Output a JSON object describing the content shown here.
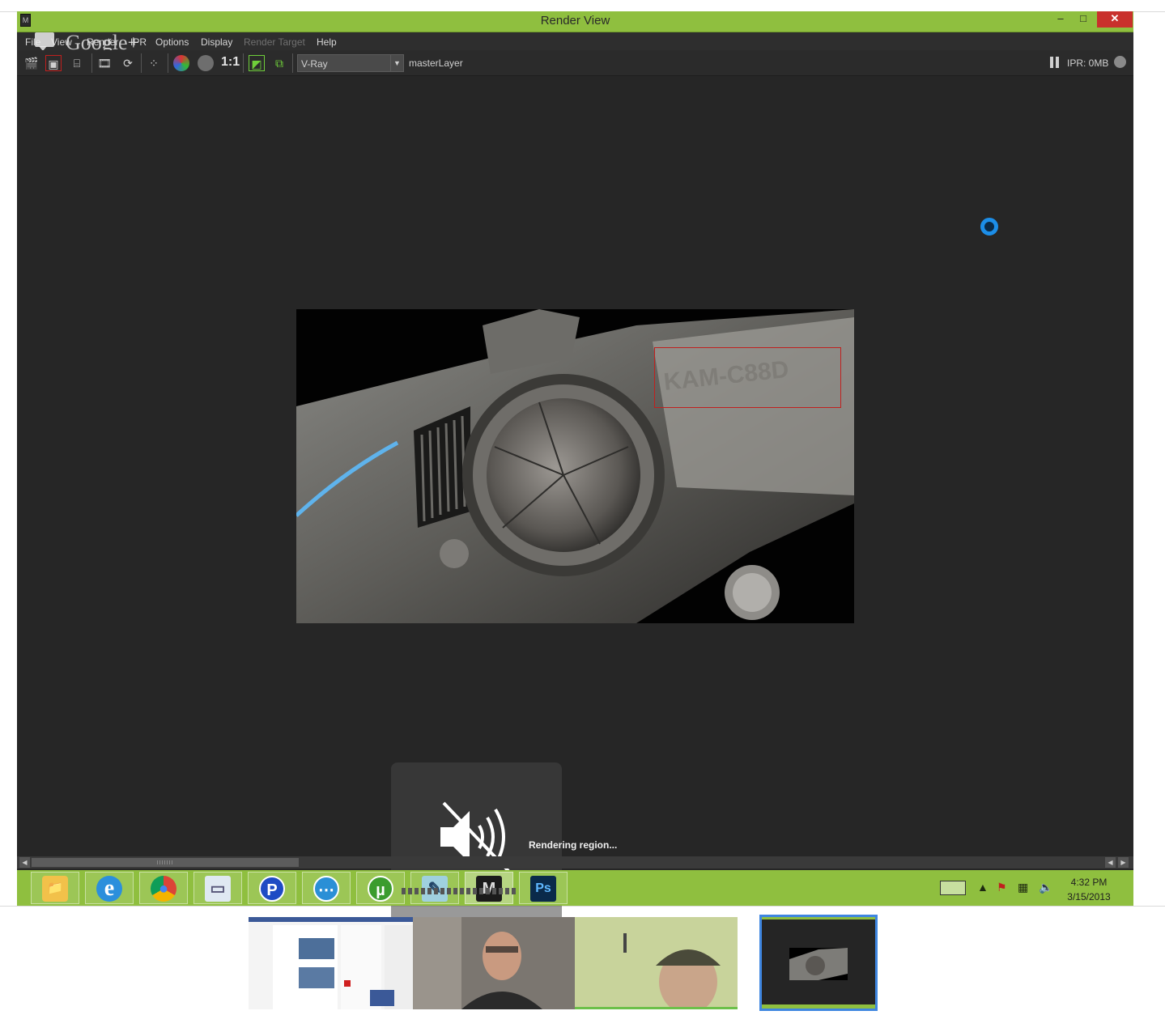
{
  "window": {
    "title": "Render View",
    "controls": {
      "minimize": "–",
      "maximize": "□",
      "close": "✕"
    }
  },
  "overlay": {
    "brand": "Google+"
  },
  "menu": {
    "items": [
      {
        "label": "File",
        "enabled": true
      },
      {
        "label": "View",
        "enabled": true
      },
      {
        "label": "Render",
        "enabled": true
      },
      {
        "label": "IPR",
        "enabled": true
      },
      {
        "label": "Options",
        "enabled": true
      },
      {
        "label": "Display",
        "enabled": true
      },
      {
        "label": "Render Target",
        "enabled": false
      },
      {
        "label": "Help",
        "enabled": true
      }
    ]
  },
  "toolbar": {
    "ratio_label": "1:1",
    "renderer": "V-Ray",
    "layer": "masterLayer",
    "ipr_status": "IPR: 0MB",
    "icons": [
      "clapper-icon",
      "region-render-icon",
      "snapshot-icon",
      "ipr-render-icon",
      "refresh-icon",
      "ipr-region-icon",
      "rgb-channels-icon",
      "alpha-icon",
      "keep-image-icon",
      "remove-image-icon"
    ]
  },
  "render": {
    "status": "Rendering region...",
    "image_text": "KAM-C88D"
  },
  "taskbar": {
    "apps": [
      {
        "name": "file-explorer",
        "glyph": "📁"
      },
      {
        "name": "internet-explorer",
        "glyph": "e"
      },
      {
        "name": "chrome",
        "glyph": "●"
      },
      {
        "name": "image-viewer",
        "glyph": "▭"
      },
      {
        "name": "pandora",
        "glyph": "P"
      },
      {
        "name": "dots-app",
        "glyph": "⋯"
      },
      {
        "name": "utorrent",
        "glyph": "µ"
      },
      {
        "name": "notes-app",
        "glyph": "✎"
      },
      {
        "name": "maya",
        "glyph": "M"
      },
      {
        "name": "photoshop",
        "glyph": "Ps"
      }
    ],
    "clock": {
      "time": "4:32 PM",
      "date": "3/15/2013"
    }
  },
  "participants": [
    {
      "name": "participant-screen-share"
    },
    {
      "name": "participant-webcam-1"
    },
    {
      "name": "participant-webcam-2"
    },
    {
      "name": "participant-render-share",
      "active": true
    }
  ],
  "colors": {
    "title_green": "#8fbf3f",
    "viewport_bg": "#262626",
    "region_red": "#c0201e",
    "accent_blue": "#1c8ee8",
    "active_thumb_border": "#3f86e0"
  }
}
